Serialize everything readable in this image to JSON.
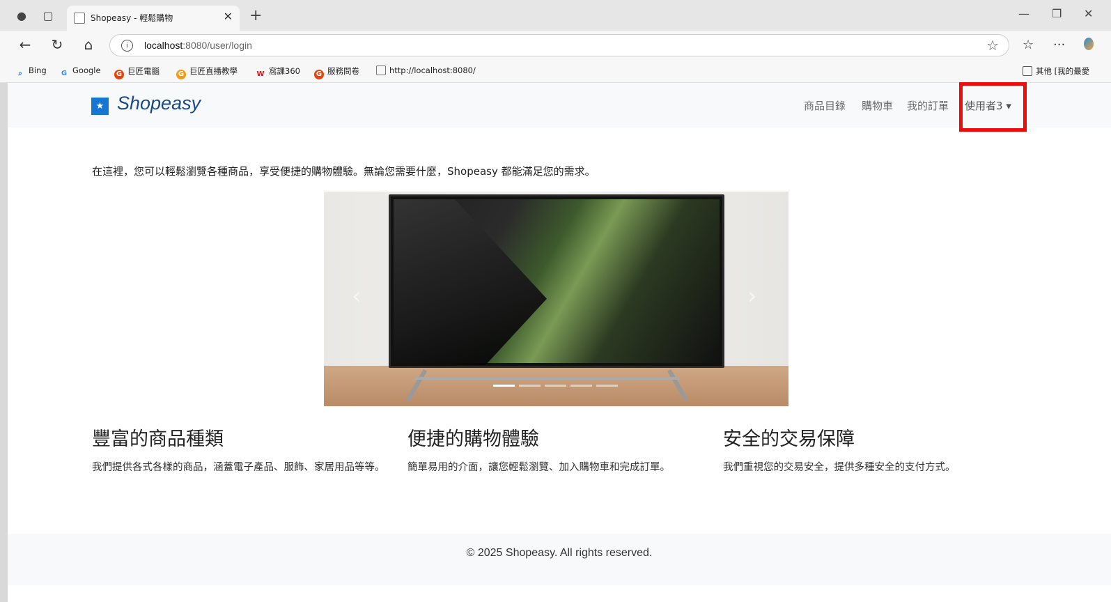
{
  "browser": {
    "tab_title": "Shopeasy - 輕鬆購物",
    "url_host": "localhost",
    "url_path": ":8080/user/login",
    "bookmarks": [
      {
        "label": "Bing",
        "icon": "search-icon",
        "color": "#1a73e8"
      },
      {
        "label": "Google",
        "icon": "google-icon",
        "color": "#4285f4"
      },
      {
        "label": "巨匠電腦",
        "icon": "g-logo-icon",
        "color": "#e8420e"
      },
      {
        "label": "巨匠直播教學",
        "icon": "g-logo-icon",
        "color": "#f39c12"
      },
      {
        "label": "窩課360",
        "icon": "w-logo-icon",
        "color": "#d6131a"
      },
      {
        "label": "服務問卷",
        "icon": "g-logo-icon",
        "color": "#e8420e"
      },
      {
        "label": "http://localhost:8080/",
        "icon": "page-icon",
        "color": "#777777"
      }
    ],
    "other_bookmarks": "其他 [我的最愛"
  },
  "navbar": {
    "brand": "Shopeasy",
    "links": [
      "商品目錄",
      "購物車",
      "我的訂單",
      "使用者3"
    ]
  },
  "main": {
    "intro": "在這裡，您可以輕鬆瀏覽各種商品，享受便捷的購物體驗。無論您需要什麼，Shopeasy 都能滿足您的需求。",
    "carousel": {
      "slides": 5,
      "active": 1
    },
    "features": [
      {
        "title": "豐富的商品種類",
        "text": "我們提供各式各樣的商品，涵蓋電子產品、服飾、家居用品等等。"
      },
      {
        "title": "便捷的購物體驗",
        "text": "簡單易用的介面，讓您輕鬆瀏覽、加入購物車和完成訂單。"
      },
      {
        "title": "安全的交易保障",
        "text": "我們重視您的交易安全，提供多種安全的支付方式。"
      }
    ]
  },
  "footer": {
    "text": "© 2025 Shopeasy. All rights reserved."
  }
}
